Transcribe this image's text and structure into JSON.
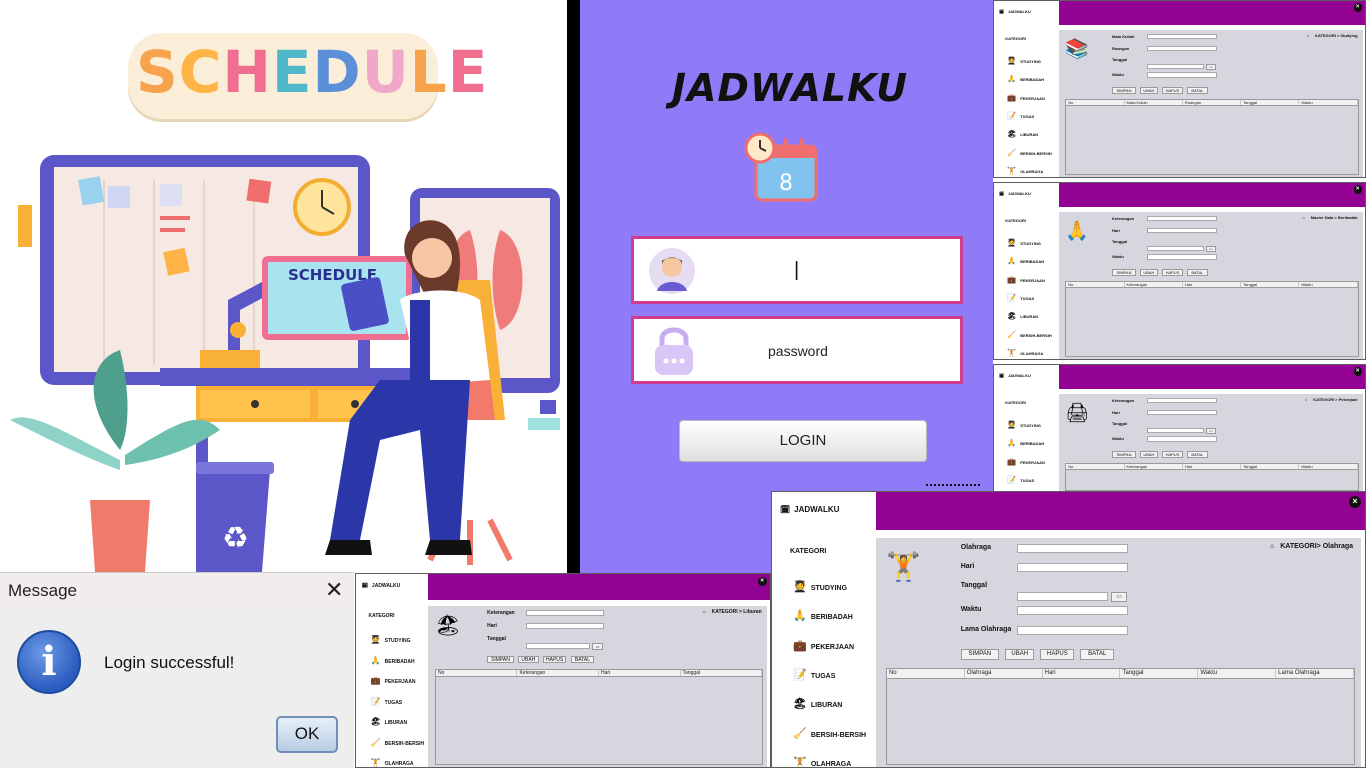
{
  "illustration": {
    "logo_text": "SCHEDULE",
    "monitor_label": "SCHEDULE"
  },
  "login": {
    "title": "JADWALKU",
    "calendar_day": "8",
    "username_value": "|",
    "password_value": "password",
    "login_button": "LOGIN",
    "background": "#8f7bf8",
    "field_border": "#d23c8e"
  },
  "message_dialog": {
    "title": "Message",
    "close": "✕",
    "icon_letter": "i",
    "text": "Login successful!",
    "ok_button": "OK"
  },
  "app": {
    "brand": "JADWALKU",
    "kategori_label": "KATEGORI",
    "accent": "#930293",
    "content_bg": "#d6d7de",
    "menu": [
      "STUDYING",
      "BERIBADAH",
      "PEKERJAAN",
      "TUGAS",
      "LIBURAN",
      "BERSIH-BERSIH",
      "OLAHRAGA"
    ],
    "buttons": [
      "SIMPAN",
      "UBAH",
      "HAPUS",
      "BATAL"
    ],
    "calendar_button": "▭"
  },
  "windows": {
    "studying": {
      "breadcrumb": "KATEGORI > Studying",
      "fields": [
        "Mata Kuliah",
        "Ruangan",
        "Tanggal",
        "Waktu"
      ],
      "columns": [
        "No",
        "Mata Kuliah",
        "Ruangan",
        "Tanggal",
        "Waktu"
      ]
    },
    "beribadah": {
      "breadcrumb": "Master Data > Beribadah",
      "fields": [
        "Keterangan",
        "Hari",
        "Tanggal",
        "Waktu"
      ],
      "columns": [
        "No",
        "Keterangan",
        "Hari",
        "Tanggal",
        "Waktu"
      ]
    },
    "pekerjaan": {
      "breadcrumb": "KATEGORI > Pekerjaan",
      "fields": [
        "Keterangan",
        "Hari",
        "Tanggal",
        "Waktu"
      ],
      "columns": [
        "No",
        "Keterangan",
        "Hari",
        "Tanggal",
        "Waktu"
      ]
    },
    "liburan": {
      "breadcrumb": "KATEGORI > Liburan",
      "fields": [
        "Keterangan",
        "Hari",
        "Tanggal"
      ],
      "columns": [
        "No",
        "Keterangan",
        "Hari",
        "Tanggal"
      ]
    },
    "olahraga": {
      "breadcrumb": "KATEGORI> Olahraga",
      "fields": [
        "Olahraga",
        "Hari",
        "Tanggal",
        "Waktu",
        "Lama Olahraga"
      ],
      "columns": [
        "No",
        "Olahraga",
        "Hari",
        "Tanggal",
        "Waktu",
        "Lama Olahraga"
      ]
    }
  }
}
